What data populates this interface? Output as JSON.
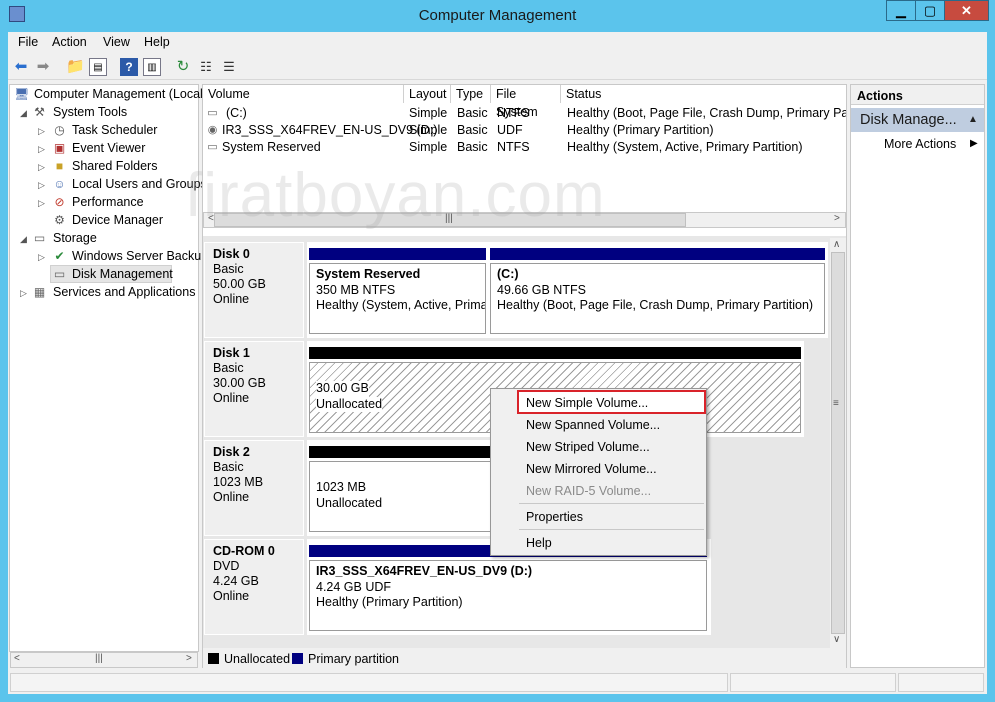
{
  "window": {
    "title": "Computer Management",
    "minimize": "▁",
    "maximize": "▢",
    "close": "✕"
  },
  "menu": [
    "File",
    "Action",
    "View",
    "Help"
  ],
  "tree": {
    "root": "Computer Management (Local",
    "system_tools": "System Tools",
    "items": [
      "Task Scheduler",
      "Event Viewer",
      "Shared Folders",
      "Local Users and Groups",
      "Performance",
      "Device Manager"
    ],
    "storage": "Storage",
    "storage_items": [
      "Windows Server Backup",
      "Disk Management"
    ],
    "services": "Services and Applications"
  },
  "volumes": {
    "headers": [
      "Volume",
      "Layout",
      "Type",
      "File System",
      "Status"
    ],
    "rows": [
      {
        "volume": "(C:)",
        "layout": "Simple",
        "type": "Basic",
        "fs": "NTFS",
        "status": "Healthy (Boot, Page File, Crash Dump, Primary Partiti"
      },
      {
        "volume": "IR3_SSS_X64FREV_EN-US_DV9 (D:)",
        "layout": "Simple",
        "type": "Basic",
        "fs": "UDF",
        "status": "Healthy (Primary Partition)"
      },
      {
        "volume": "System Reserved",
        "layout": "Simple",
        "type": "Basic",
        "fs": "NTFS",
        "status": "Healthy (System, Active, Primary Partition)"
      }
    ]
  },
  "disks": [
    {
      "label": "Disk 0",
      "type": "Basic",
      "size": "50.00 GB",
      "state": "Online"
    },
    {
      "label": "Disk 1",
      "type": "Basic",
      "size": "30.00 GB",
      "state": "Online"
    },
    {
      "label": "Disk 2",
      "type": "Basic",
      "size": "1023 MB",
      "state": "Online"
    },
    {
      "label": "CD-ROM 0",
      "type": "DVD",
      "size": "4.24 GB",
      "state": "Online"
    }
  ],
  "partitions": {
    "sysres": {
      "name": "System Reserved",
      "size": "350 MB NTFS",
      "status": "Healthy (System, Active, Primar"
    },
    "c": {
      "name": "(C:)",
      "size": "49.66 GB NTFS",
      "status": "Healthy (Boot, Page File, Crash Dump, Primary Partition)"
    },
    "disk1": {
      "size": "30.00 GB",
      "status": "Unallocated"
    },
    "disk2": {
      "size": "1023 MB",
      "status": "Unallocated"
    },
    "cd": {
      "name": "IR3_SSS_X64FREV_EN-US_DV9  (D:)",
      "size": "4.24 GB UDF",
      "status": "Healthy (Primary Partition)"
    }
  },
  "legend": {
    "unallocated": "Unallocated",
    "primary": "Primary partition"
  },
  "actions": {
    "header": "Actions",
    "section": "Disk Manage...",
    "more": "More Actions"
  },
  "context_menu": {
    "items": [
      "New Simple Volume...",
      "New Spanned Volume...",
      "New Striped Volume...",
      "New Mirrored Volume...",
      "New RAID-5 Volume...",
      "Properties",
      "Help"
    ]
  },
  "watermark": "firatboyan.com",
  "colors": {
    "titlebar": "#5bc4ec",
    "primary": "#000080",
    "unallocated": "#000000",
    "highlight": "#d9232a"
  }
}
